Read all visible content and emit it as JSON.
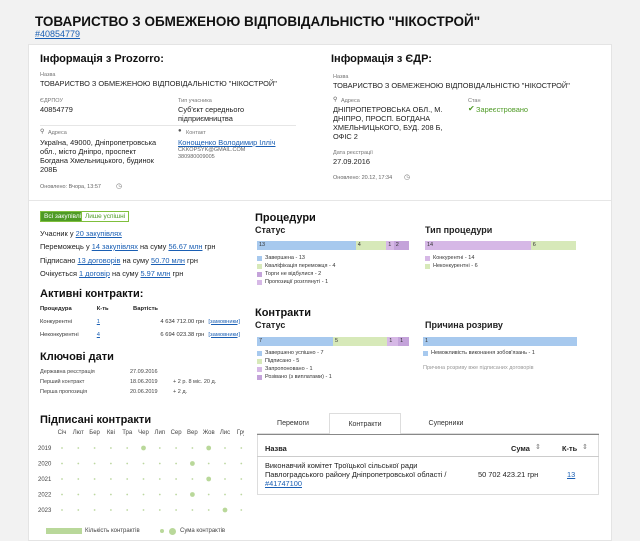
{
  "header": {
    "title": "ТОВАРИСТВО З ОБМЕЖЕНОЮ ВІДПОВІДАЛЬНІСТЮ \"НІКОСТРОЙ\"",
    "id": "#40854779"
  },
  "prozorro": {
    "title": "Інформація з Prozorro:",
    "name_label": "Назва",
    "name": "ТОВАРИСТВО З ОБМЕЖЕНОЮ ВІДПОВІДАЛЬНІСТЮ \"НІКОСТРОЙ\"",
    "edrpou_label": "ЄДРПОУ",
    "edrpou": "40854779",
    "type_label": "Тип учасника",
    "type": "Суб'єкт середнього підприємництва",
    "address_label": "Адреса",
    "address": "Україна, 49000, Дніпропетровська обл., місто Дніпро, проспект Богдана Хмельницького, будинок 208Б",
    "contact_label": "Контакт",
    "contact_name": "Конощенко Володимир Ілліч",
    "contact_email": "CKKOPSYK@GMAIL.COM",
    "contact_phone": "380980009005",
    "updated": "Оновлено: Вчора, 13:57"
  },
  "edr": {
    "title": "Інформація з ЄДР:",
    "name_label": "Назва",
    "name": "ТОВАРИСТВО З ОБМЕЖЕНОЮ ВІДПОВІДАЛЬНІСТЮ \"НІКОСТРОЙ\"",
    "address_label": "Адреса",
    "address": "ДНІПРОПЕТРОВСЬКА ОБЛ., М. ДНІПРО, ПРОСП. БОГДАНА ХМЕЛЬНИЦЬКОГО, БУД. 208 Б, ОФІС 2",
    "status_label": "Стан",
    "status": "Зареєстровано",
    "reg_label": "Дата реєстрації",
    "reg_date": "27.09.2016",
    "updated": "Оновлено: 20.12, 17:34"
  },
  "filters": {
    "all": "Всі закупівлі",
    "won": "Лише успішні"
  },
  "summary": {
    "l1_pre": "Учасник у ",
    "l1_link": "20 закупівлях",
    "l2_pre": "Переможець у ",
    "l2_link": "14 закупівлях",
    "l2_mid": " на суму ",
    "l2_sum": "56.67 млн",
    "l2_cur": " грн",
    "l3_pre": "Підписано ",
    "l3_link": "13 договорів",
    "l3_mid": " на суму ",
    "l3_sum": "50.70 млн",
    "l3_cur": " грн",
    "l4_pre": "Очікується ",
    "l4_link": "1 договір",
    "l4_mid": " на суму ",
    "l4_sum": "5.97 млн",
    "l4_cur": " грн"
  },
  "active": {
    "title": "Активні контракти:",
    "col_proc": "Процедура",
    "col_count": "К-ть",
    "col_value": "Вартість",
    "rows": [
      {
        "proc": "Конкурентні",
        "count": "1",
        "value": "4 634 712.00 грн",
        "link": "[замовники]"
      },
      {
        "proc": "Неконкурентні",
        "count": "4",
        "value": "6 694 023.38 грн",
        "link": "[замовники]"
      }
    ]
  },
  "dates": {
    "title": "Ключові дати",
    "rows": [
      {
        "label": "Державна реєстрація",
        "date": "27.09.2016",
        "extra": ""
      },
      {
        "label": "Перший контракт",
        "date": "18.06.2019",
        "extra": "+ 2 р. 8 міс. 20 д."
      },
      {
        "label": "Перша пропозиція",
        "date": "20.06.2019",
        "extra": "+ 2 д."
      }
    ]
  },
  "signed": {
    "title": "Підписані контракти",
    "months": [
      "Січ",
      "Лют",
      "Бер",
      "Кві",
      "Тра",
      "Чер",
      "Лип",
      "Сер",
      "Вер",
      "Жов",
      "Лис",
      "Гру"
    ],
    "years": [
      "2019",
      "2020",
      "2021",
      "2022",
      "2023"
    ],
    "legend_count": "Кількість контрактів",
    "legend_sum": "Сума контрактів",
    "big_points": [
      {
        "year": "2019",
        "month": "Чер"
      },
      {
        "year": "2019",
        "month": "Жов"
      },
      {
        "year": "2020",
        "month": "Вер"
      },
      {
        "year": "2021",
        "month": "Жов"
      },
      {
        "year": "2022",
        "month": "Вер"
      },
      {
        "year": "2023",
        "month": "Лис"
      }
    ]
  },
  "procedures": {
    "title": "Процедури",
    "status": {
      "title": "Статус",
      "bar": [
        {
          "value": 13,
          "label": "13",
          "color": "#a7c9ee"
        },
        {
          "value": 4,
          "label": "4",
          "color": "#d7e9b9"
        },
        {
          "value": 1,
          "label": "1",
          "color": "#d6b8e6"
        },
        {
          "value": 2,
          "label": "2",
          "color": "#c4a3da"
        }
      ],
      "legend": [
        {
          "label": "Завершена - 13",
          "color": "#a7c9ee"
        },
        {
          "label": "Кваліфікація переможця - 4",
          "color": "#d7e9b9"
        },
        {
          "label": "Торги не відбулися - 2",
          "color": "#c4a3da"
        },
        {
          "label": "Пропозиції розглянуті - 1",
          "color": "#d6b8e6"
        }
      ]
    },
    "type": {
      "title": "Тип процедури",
      "bar": [
        {
          "value": 14,
          "label": "14",
          "color": "#d6b8e6"
        },
        {
          "value": 6,
          "label": "6",
          "color": "#d7e9b9"
        }
      ],
      "legend": [
        {
          "label": "Конкурентні - 14",
          "color": "#d6b8e6"
        },
        {
          "label": "Неконкурентні - 6",
          "color": "#d7e9b9"
        }
      ]
    }
  },
  "contracts": {
    "title": "Контракти",
    "status": {
      "title": "Статус",
      "bar": [
        {
          "value": 7,
          "label": "7",
          "color": "#a7c9ee"
        },
        {
          "value": 5,
          "label": "5",
          "color": "#d7e9b9"
        },
        {
          "value": 1,
          "label": "1",
          "color": "#d6b8e6"
        },
        {
          "value": 1,
          "label": "1",
          "color": "#c4a3da"
        }
      ],
      "legend": [
        {
          "label": "Завершено успішно - 7",
          "color": "#a7c9ee"
        },
        {
          "label": "Підписано - 5",
          "color": "#d7e9b9"
        },
        {
          "label": "Запропоновано - 1",
          "color": "#d6b8e6"
        },
        {
          "label": "Розівано (з виплатами) - 1",
          "color": "#c4a3da"
        }
      ]
    },
    "reason": {
      "title": "Причина розриву",
      "bar": [
        {
          "value": 1,
          "label": "1",
          "color": "#a7c9ee"
        }
      ],
      "legend": [
        {
          "label": "Неможливість виконання зобов'язань - 1",
          "color": "#a7c9ee"
        }
      ],
      "note": "Причина розриву вже підписаних договорів"
    }
  },
  "tabs": {
    "t1": "Перемоги",
    "t2": "Контракти",
    "t3": "Суперники"
  },
  "contracts_table": {
    "col_name": "Назва",
    "col_sum": "Сума",
    "col_count": "К-ть",
    "sort_icon": "⇕",
    "row_name": "Виконавчий комітет Троїцької сільської ради Павлоградського району Дніпропетровської області / ",
    "row_link": "#41747100",
    "row_sum": "50 702 423.21 грн",
    "row_count": "13"
  },
  "icons": {
    "clock": "clock-icon",
    "location": "location-icon",
    "user": "user-icon",
    "check": "check-icon"
  }
}
